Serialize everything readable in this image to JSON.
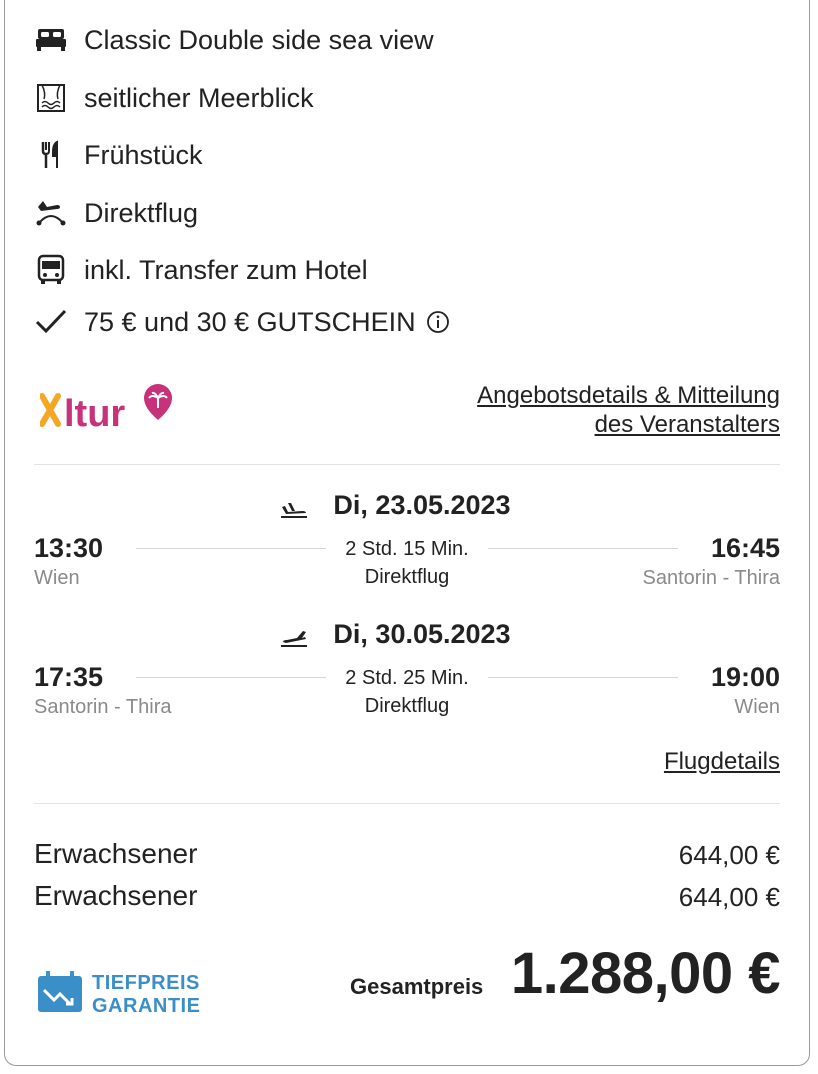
{
  "features": {
    "room": "Classic Double side sea view",
    "view": "seitlicher Meerblick",
    "board": "Frühstück",
    "flight": "Direktflug",
    "transfer": "inkl. Transfer zum Hotel",
    "voucher": "75 € und 30 € GUTSCHEIN"
  },
  "operator": {
    "logo_text": "Xltur",
    "details_line1": "Angebotsdetails & Mitteilung",
    "details_line2": "des Veranstalters"
  },
  "outbound": {
    "date": "Di, 23.05.2023",
    "dep_time": "13:30",
    "dep_place": "Wien",
    "duration": "2 Std. 15 Min.",
    "type": "Direktflug",
    "arr_time": "16:45",
    "arr_place": "Santorin - Thira"
  },
  "return": {
    "date": "Di, 30.05.2023",
    "dep_time": "17:35",
    "dep_place": "Santorin - Thira",
    "duration": "2 Std. 25 Min.",
    "type": "Direktflug",
    "arr_time": "19:00",
    "arr_place": "Wien"
  },
  "flight_details_link": "Flugdetails",
  "prices": {
    "rows": [
      {
        "label": "Erwachsener",
        "value": "644,00 €"
      },
      {
        "label": "Erwachsener",
        "value": "644,00 €"
      }
    ],
    "guarantee_line1": "TIEFPREIS",
    "guarantee_line2": "GARANTIE",
    "total_label": "Gesamtpreis",
    "total_value": "1.288,00 €"
  },
  "colors": {
    "brand_orange": "#f5a623",
    "brand_magenta": "#c8327a",
    "guarantee_blue": "#3a8fc9"
  }
}
